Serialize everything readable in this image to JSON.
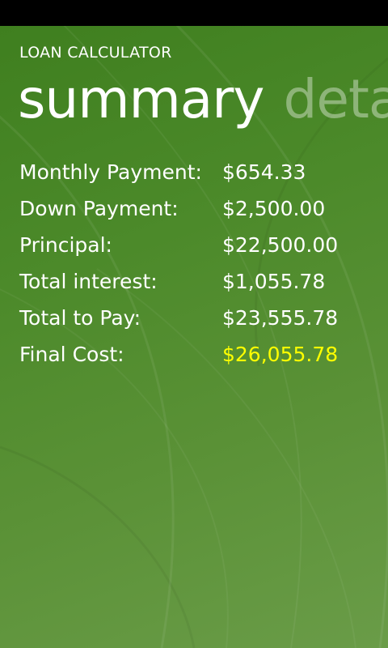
{
  "app": {
    "title": "LOAN CALCULATOR"
  },
  "pivot": {
    "active": "summary",
    "next": "detai"
  },
  "summary": {
    "rows": [
      {
        "label": "Monthly Payment:",
        "value": "$654.33"
      },
      {
        "label": "Down Payment:",
        "value": "$2,500.00"
      },
      {
        "label": "Principal:",
        "value": "$22,500.00"
      },
      {
        "label": "Total interest:",
        "value": "$1,055.78"
      },
      {
        "label": "Total to Pay:",
        "value": "$23,555.78"
      },
      {
        "label": "Final Cost:",
        "value": "$26,055.78"
      }
    ]
  },
  "colors": {
    "background": "#4c8a2a",
    "text": "#ffffff",
    "highlight": "#ffff00"
  }
}
